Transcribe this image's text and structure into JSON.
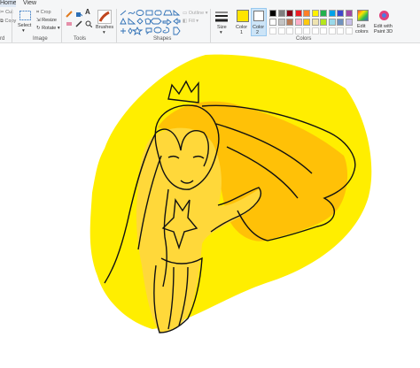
{
  "tabs": {
    "home": "Home",
    "view": "View"
  },
  "clipboard": {
    "cut": "Cut",
    "copy": "Copy",
    "paste_group": "rd"
  },
  "image": {
    "select": "Select",
    "crop": "Crop",
    "resize": "Resize",
    "rotate": "Rotate",
    "group": "Image"
  },
  "tools": {
    "group": "Tools"
  },
  "brushes": {
    "label": "Brushes"
  },
  "shapes": {
    "outline": "Outline",
    "fill": "Fill",
    "group": "Shapes"
  },
  "size": {
    "label": "Size"
  },
  "color1": {
    "label": "Color",
    "num": "1",
    "value": "#ffe400"
  },
  "color2": {
    "label": "Color",
    "num": "2",
    "value": "#ffffff"
  },
  "colors": {
    "group": "Colors",
    "palette": [
      "#000000",
      "#7f7f7f",
      "#880015",
      "#ed1c24",
      "#ff7f27",
      "#fff200",
      "#22b14c",
      "#00a2e8",
      "#3f48cc",
      "#a349a4",
      "#ffffff",
      "#c3c3c3",
      "#b97a57",
      "#ffaec9",
      "#ffc90e",
      "#efe4b0",
      "#b5e61d",
      "#99d9ea",
      "#7092be",
      "#c8bfe7"
    ],
    "custom": [
      "#ffffff",
      "#ffffff",
      "#ffffff",
      "#ffffff",
      "#ffffff",
      "#ffffff",
      "#ffffff",
      "#ffffff",
      "#ffffff",
      "#ffffff"
    ]
  },
  "edit_colors": {
    "l1": "Edit",
    "l2": "colors"
  },
  "paint3d": {
    "l1": "Edit with",
    "l2": "Paint 3D"
  },
  "canvas": {
    "background": "#ffffff",
    "splash": "#ffee00",
    "hair": "#ffc107",
    "skin": "#ffd83a",
    "ink": "#111111"
  }
}
